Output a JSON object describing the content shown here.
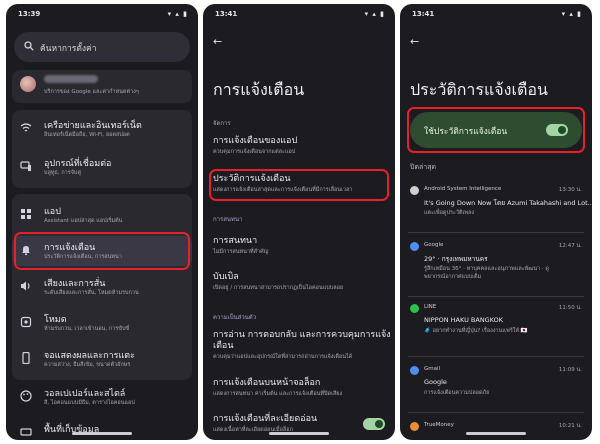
{
  "status_bars": [
    {
      "time": "13:39",
      "icons": "▾ ▴ ▮"
    },
    {
      "time": "13:41",
      "icons": "▾ ▴ ▮"
    },
    {
      "time": "13:41",
      "icons": "▾ ▴ ▮"
    }
  ],
  "screen1": {
    "search_placeholder": "ค้นหาการตั้งค่า",
    "account_sub": "บริการของ Google และค่ากำหนดต่างๆ",
    "items": [
      {
        "title": "เครือข่ายและอินเทอร์เน็ต",
        "sub": "อินเทอร์เน็ตมือถือ, Wi-Fi, ฮอตสปอต",
        "icon": "wifi-icon"
      },
      {
        "title": "อุปกรณ์ที่เชื่อมต่อ",
        "sub": "บลูทูธ, การจับคู่",
        "icon": "devices-icon"
      },
      {
        "title": "แอป",
        "sub": "Assistant แอปล่าสุด แอปเริ่มต้น",
        "icon": "apps-icon"
      },
      {
        "title": "การแจ้งเตือน",
        "sub": "ประวัติการแจ้งเตือน, การสนทนา",
        "icon": "bell-icon"
      },
      {
        "title": "เสียงและการสั่น",
        "sub": "ระดับเสียงและการสั่น, โหมดห้ามรบกวน",
        "icon": "volume-icon"
      },
      {
        "title": "โหมด",
        "sub": "ห้ามรบกวน, เวลาเข้านอน, การขับขี่",
        "icon": "modes-icon"
      },
      {
        "title": "จอแสดงผลและการแตะ",
        "sub": "ความสว่าง, ธีมสีเข้ม, ขนาดตัวอักษร",
        "icon": "display-icon"
      },
      {
        "title": "วอลเปเปอร์และสไตล์",
        "sub": "สี, ไอคอนแบบมีธีม, ตารางไอคอนแอป",
        "icon": "palette-icon"
      },
      {
        "title": "พื้นที่เก็บข้อมูล",
        "sub": "",
        "icon": "storage-icon"
      }
    ]
  },
  "screen2": {
    "title": "การแจ้งเตือน",
    "section_manage": "จัดการ",
    "section_conversation": "การสนทนา",
    "section_privacy": "ความเป็นส่วนตัว",
    "items": [
      {
        "title": "การแจ้งเตือนของแอป",
        "sub": "ควบคุมการแจ้งเตือนจากแต่ละแอป"
      },
      {
        "title": "ประวัติการแจ้งเตือน",
        "sub": "แสดงการแจ้งเตือนล่าสุดและการแจ้งเตือนที่มีการเลื่อนเวลา"
      },
      {
        "title": "การสนทนา",
        "sub": "ไม่มีการสนทนาที่สำคัญ"
      },
      {
        "title": "บับเบิล",
        "sub": "เปิดอยู่ / การสนทนาสามารถปรากฏเป็นไอคอนแบบลอย"
      },
      {
        "title": "การอ่าน การตอบกลับ และการควบคุมการแจ้ง",
        "title2": "เตือน",
        "sub": "ควบคุมว่าแอปและอุปกรณ์ใดที่สามารถอ่านการแจ้งเตือนได้"
      },
      {
        "title": "การแจ้งเตือนบนหน้าจอล็อก",
        "sub": "แสดงการสนทนา ค่าเริ่มต้น และการแจ้งเตือนที่ปิดเสียง"
      },
      {
        "title": "การแจ้งเตือนที่ละเอียดอ่อน",
        "sub": "แสดงเนื้อหาที่ละเอียดอ่อนเมื่อล็อก"
      }
    ]
  },
  "screen3": {
    "title": "ประวัติการแจ้งเตือน",
    "use_label": "ใช้ประวัติการแจ้งเตือน",
    "recent_label": "ปิดล่าสุด",
    "notifications": [
      {
        "app": "Android System Intelligence",
        "time": "13:30 น.",
        "title": "It's Going Down Now โดย Azumi Takahashi and Lot...",
        "sub": "แตะเพื่อดูประวัติเพลง",
        "sub2": "",
        "color": "#cfcfcf"
      },
      {
        "app": "Google",
        "time": "12:47 น.",
        "title": "29° · กรุงเทพมหานคร",
        "sub": "รู้สึกเหมือน 36° · หาบุคคลและอนุภาพและพัฒนา · ดู",
        "sub2": "พยากรณ์อากาศแบบเต็ม",
        "color": "#4f8ef0"
      },
      {
        "app": "LINE",
        "time": "11:50 น.",
        "title": "NIPPON HAKU BANGKOK",
        "sub": "🧳 อยากทำงานที่ญี่ปุ่น? เรื่องงานแฟร์ให้ 🇯🇵",
        "sub2": "",
        "color": "#2fbf4f"
      },
      {
        "app": "Gmail",
        "time": "11:09 น.",
        "title": "Google",
        "sub": "การแจ้งเตือนความปลอดภัย",
        "sub2": "",
        "color": "#4f8ef0"
      },
      {
        "app": "TrueMoney",
        "time": "10:21 น.",
        "title": "",
        "sub": "",
        "sub2": "",
        "color": "#e89030"
      }
    ]
  }
}
